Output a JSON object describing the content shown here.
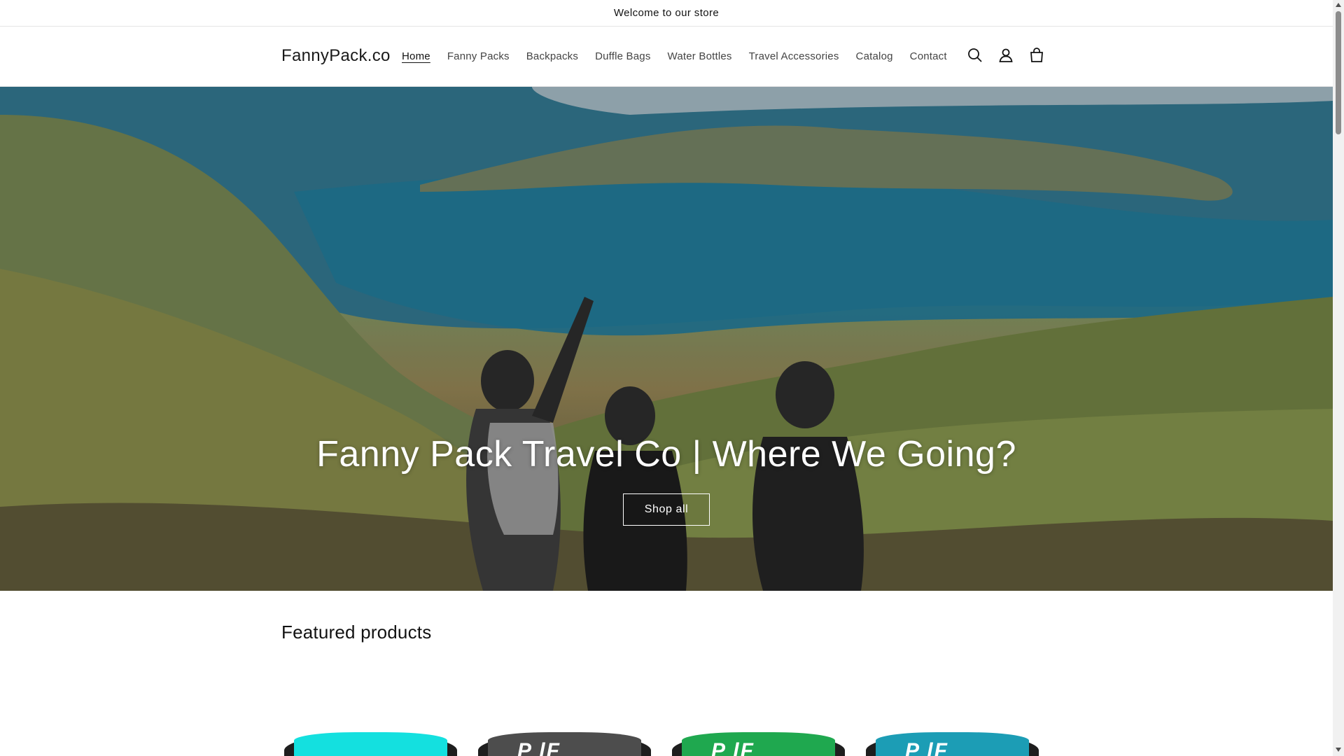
{
  "announcement": {
    "text": "Welcome to our store"
  },
  "header": {
    "logo": "FannyPack.co",
    "nav": [
      {
        "label": "Home",
        "active": true
      },
      {
        "label": "Fanny Packs"
      },
      {
        "label": "Backpacks"
      },
      {
        "label": "Duffle Bags"
      },
      {
        "label": "Water Bottles"
      },
      {
        "label": "Travel Accessories"
      },
      {
        "label": "Catalog"
      },
      {
        "label": "Contact"
      }
    ],
    "icons": [
      "search-icon",
      "account-icon",
      "cart-icon"
    ]
  },
  "hero": {
    "title": "Fanny Pack Travel Co | Where We Going?",
    "button": "Shop all"
  },
  "featured": {
    "title": "Featured products",
    "products": [
      {
        "color": "#14e0df",
        "mark": ""
      },
      {
        "color": "#4d4d4d",
        "mark": "P  lF"
      },
      {
        "color": "#1fa84f",
        "mark": "P  lF"
      },
      {
        "color": "#1c9db5",
        "mark": "P  lF"
      }
    ]
  },
  "colors": {
    "text": "#121212",
    "border": "#e5e5e5",
    "hero_button_border": "#ffffff"
  }
}
